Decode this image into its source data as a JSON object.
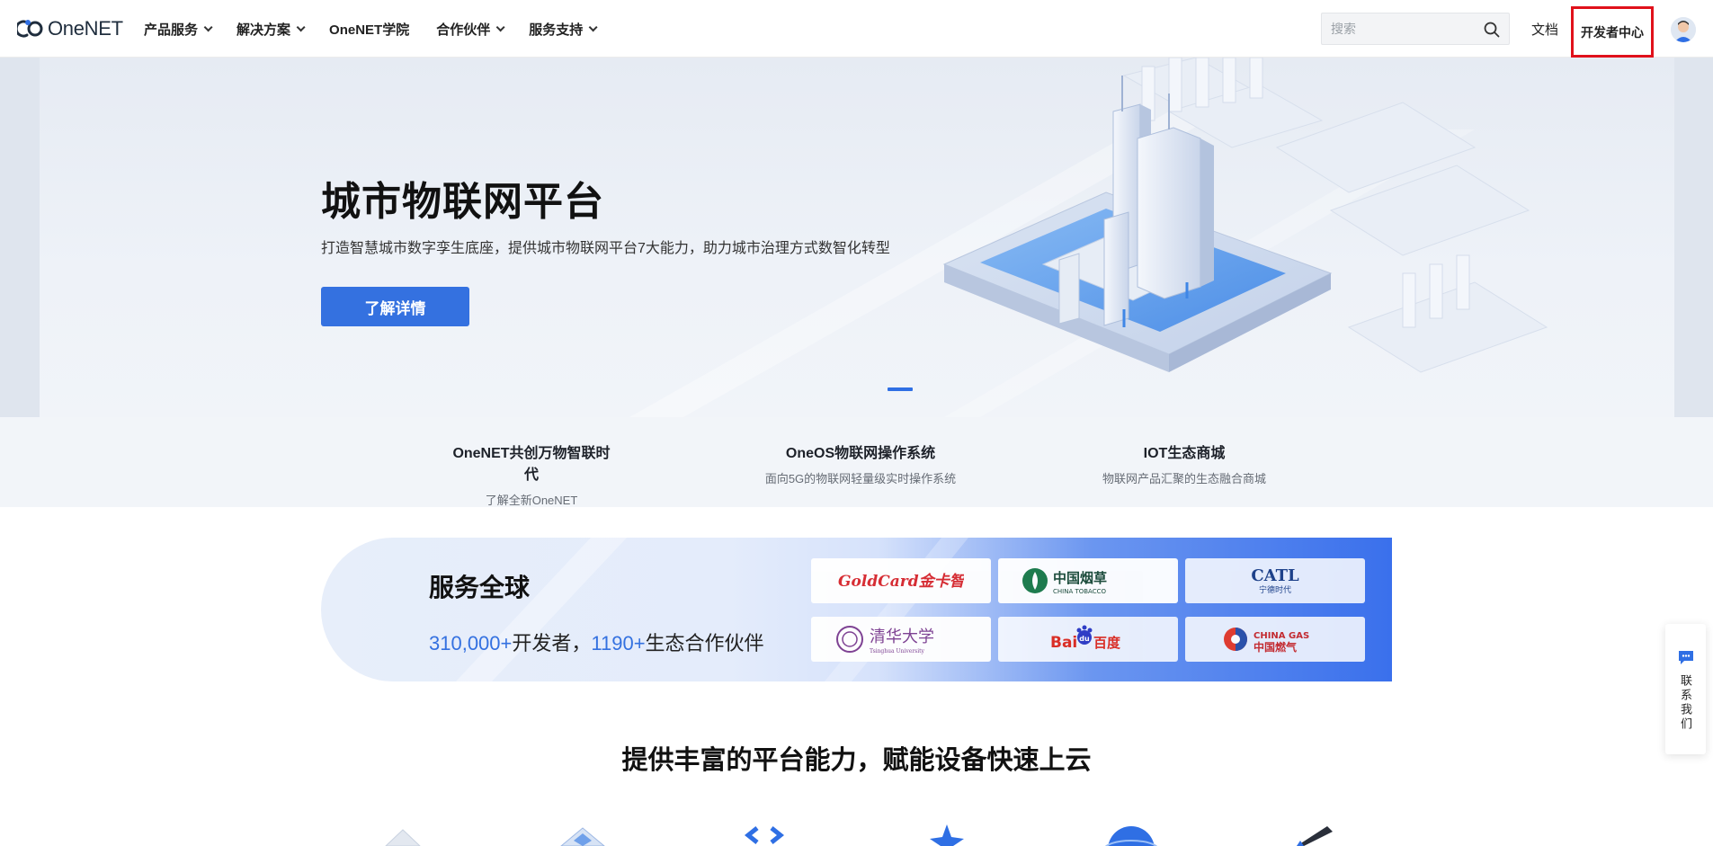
{
  "header": {
    "logo_text": "OneNET",
    "nav": [
      {
        "label": "产品服务",
        "has_dropdown": true
      },
      {
        "label": "解决方案",
        "has_dropdown": true
      },
      {
        "label": "OneNET学院",
        "has_dropdown": false
      },
      {
        "label": "合作伙伴",
        "has_dropdown": true
      },
      {
        "label": "服务支持",
        "has_dropdown": true
      }
    ],
    "search_placeholder": "搜索",
    "search_icon": "search-icon",
    "docs_label": "文档",
    "dev_center_label": "开发者中心",
    "avatar_icon": "user-avatar"
  },
  "hero": {
    "title": "城市物联网平台",
    "subtitle": "打造智慧城市数字孪生底座，提供城市物联网平台7大能力，助力城市治理方式数智化转型",
    "button_label": "了解详情",
    "accent": "#3471e0"
  },
  "strip": [
    {
      "title": "OneNET共创万物智联时代",
      "desc": "了解全新OneNET"
    },
    {
      "title": "OneOS物联网操作系统",
      "desc": "面向5G的物联网轻量级实时操作系统"
    },
    {
      "title": "IOT生态商城",
      "desc": "物联网产品汇聚的生态融合商城"
    }
  ],
  "service": {
    "title": "服务全球",
    "developers_num": "310,000+",
    "developers_label": "开发者，",
    "partners_num": "1190+",
    "partners_label": "生态合作伙伴",
    "partners": [
      {
        "name": "GoldCard金卡智能",
        "text": "GoldCard金卡智能"
      },
      {
        "name": "中国烟草",
        "text": "中国烟草",
        "sub": "CHINA TOBACCO"
      },
      {
        "name": "CATL宁德时代",
        "text": "CATL",
        "sub": "宁德时代"
      },
      {
        "name": "清华大学",
        "text": "清华大学",
        "sub": "Tsinghua University"
      },
      {
        "name": "百度",
        "text": "Bai",
        "text2": "du",
        "text3": "百度"
      },
      {
        "name": "中国燃气",
        "text": "CHINA GAS",
        "sub": "中国燃气"
      }
    ]
  },
  "section_title": "提供丰富的平台能力，赋能设备快速上云",
  "contact": {
    "label": "联系我们",
    "icon": "chat-icon"
  }
}
